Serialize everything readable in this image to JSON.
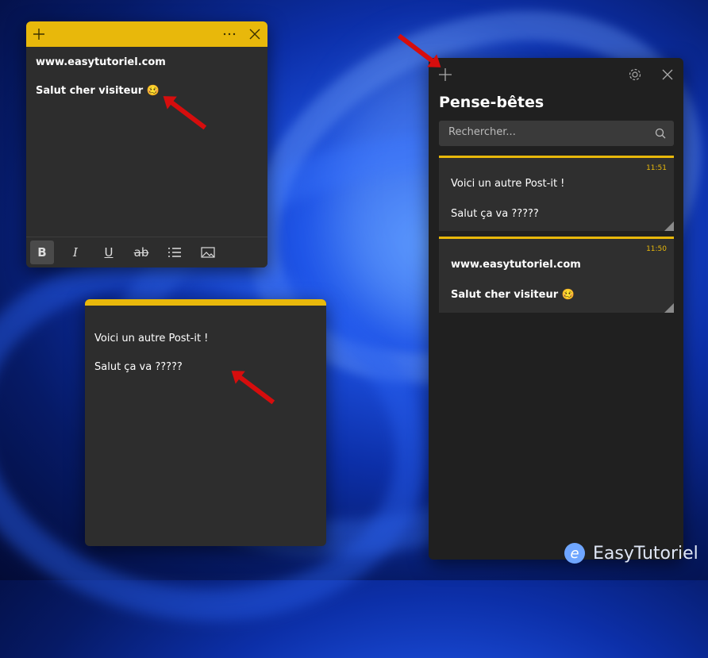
{
  "note1": {
    "lines": [
      "www.easytutoriel.com",
      "Salut cher visiteur 🥴"
    ],
    "toolbar": {
      "bold": "B",
      "italic": "I",
      "underline": "U",
      "strike": "ab"
    }
  },
  "note2": {
    "lines": [
      "Voici un autre Post-it !",
      "Salut ça va ?????"
    ]
  },
  "panel": {
    "title": "Pense-bêtes",
    "search_placeholder": "Rechercher...",
    "cards": [
      {
        "time": "11:51",
        "line1": "Voici un autre Post-it !",
        "line2": "Salut ça va ?????"
      },
      {
        "time": "11:50",
        "line1": "www.easytutoriel.com",
        "line2": "Salut cher visiteur 🥴"
      }
    ]
  },
  "brand": {
    "text": "EasyTutoriel",
    "logo_letter": "e"
  },
  "colors": {
    "note_yellow": "#e8b80b",
    "arrow_red": "#d60d0d",
    "panel_bg": "#202020"
  }
}
